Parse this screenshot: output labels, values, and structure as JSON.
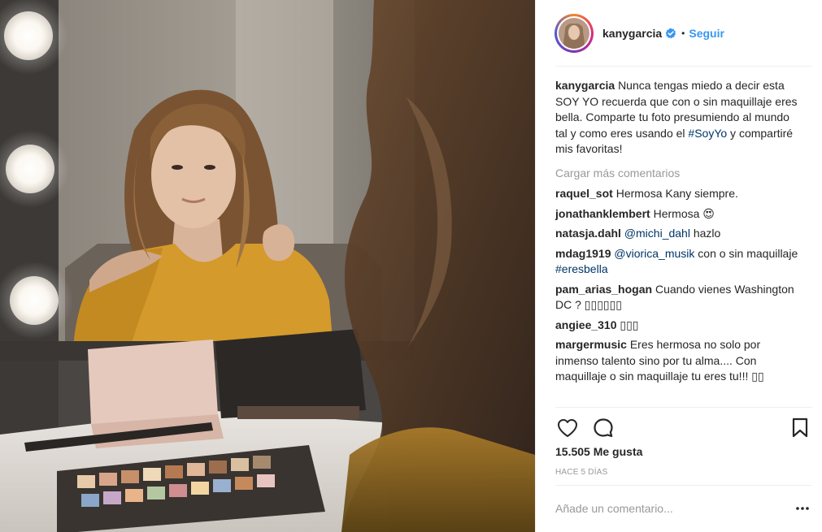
{
  "post": {
    "photo_alt": "Mujer con suéter amarillo frente a un espejo con luces"
  },
  "header": {
    "username": "kanygarcia",
    "verified_icon": "verified-badge-icon",
    "separator": "•",
    "follow_label": "Seguir"
  },
  "caption": {
    "user": "kanygarcia",
    "text_before": "Nunca tengas miedo a decir esta SOY YO recuerda que con o sin maquillaje eres bella. Comparte tu foto presumiendo al mundo tal y como eres usando el ",
    "hashtag": "#SoyYo",
    "text_after": " y compartiré mis favoritas!"
  },
  "load_more_label": "Cargar más comentarios",
  "comments": [
    {
      "user": "raquel_sot",
      "text": "Hermosa Kany siempre."
    },
    {
      "user": "jonathanklembert",
      "text": "Hermosa 😍"
    },
    {
      "user": "natasja.dahl",
      "mention": "@michi_dahl",
      "text": " hazlo"
    },
    {
      "user": "mdag1919",
      "mention": "@viorica_musik",
      "text": " con o sin maquillaje ",
      "hashtag": "#eresbella"
    },
    {
      "user": "pam_arias_hogan",
      "text": "Cuando vienes Washington DC ? ▯▯▯▯▯▯"
    },
    {
      "user": "angiee_310",
      "text": "▯▯▯"
    },
    {
      "user": "margermusic",
      "text": "Eres hermosa no solo por inmenso talento sino por tu alma.... Con maquillaje o sin maquillaje tu eres tu!!! ▯▯"
    }
  ],
  "actions": {
    "like_icon": "heart-icon",
    "comment_icon": "comment-bubble-icon",
    "save_icon": "bookmark-icon"
  },
  "likes_label": "15.505 Me gusta",
  "timestamp": "Hace 5 días",
  "add_comment": {
    "placeholder": "Añade un comentario...",
    "more_icon": "more-options-icon"
  },
  "colors": {
    "link_blue": "#3897f0",
    "mention_blue": "#003569",
    "muted_gray": "#999999",
    "text": "#262626",
    "divider": "#efefef"
  }
}
